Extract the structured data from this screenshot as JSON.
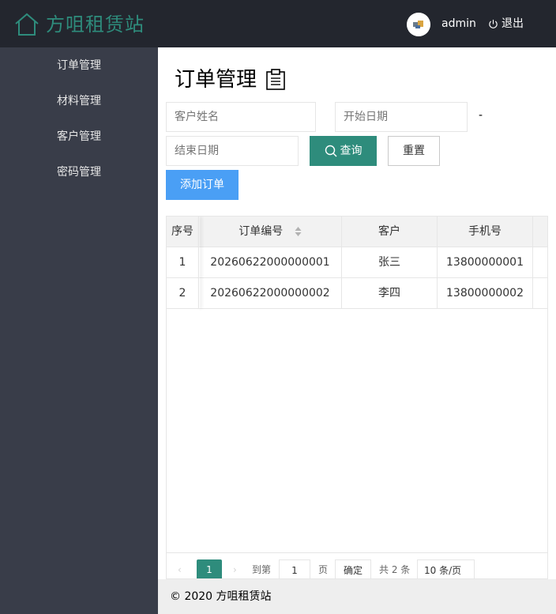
{
  "header": {
    "logo_icon": "home-icon",
    "app_title": "方咀租赁站",
    "avatar_icon": "avatar-icon",
    "username": "admin",
    "logout_icon": "power-icon",
    "logout_label": "退出"
  },
  "sidebar": {
    "items": [
      {
        "label": "订单管理"
      },
      {
        "label": "材料管理"
      },
      {
        "label": "客户管理"
      },
      {
        "label": "密码管理"
      }
    ]
  },
  "main": {
    "title": "订单管理",
    "title_icon": "clipboard-icon",
    "search": {
      "customer_placeholder": "客户姓名",
      "start_placeholder": "开始日期",
      "range_separator": "-",
      "end_placeholder": "结束日期",
      "query_icon": "search-icon",
      "query_label": "查询",
      "reset_label": "重置",
      "add_label": "添加订单"
    },
    "table": {
      "headers": [
        "序号",
        "订单编号",
        "客户",
        "手机号"
      ],
      "rows": [
        [
          "1",
          "20260622000000001",
          "张三",
          "13800000001"
        ],
        [
          "2",
          "20260622000000002",
          "李四",
          "13800000002"
        ]
      ]
    },
    "pagination": {
      "prev": "‹",
      "current": "1",
      "next": "›",
      "goto_label": "到第",
      "goto_value": "1",
      "page_label": "页",
      "confirm_label": "确定",
      "total_label": "共 2 条",
      "page_size": "10 条/页"
    }
  },
  "footer": {
    "copyright": "© 2020 方咀租赁站"
  },
  "colors": {
    "header_bg": "#23262e",
    "sidebar_bg": "#393d49",
    "brand": "#2e8c7c",
    "add_button": "#4a9ff5"
  }
}
